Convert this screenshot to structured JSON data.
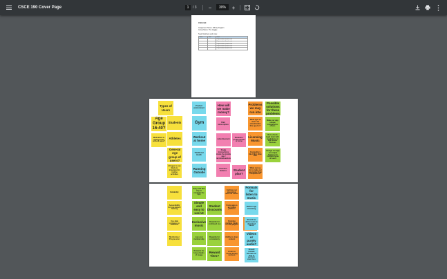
{
  "toolbar": {
    "title": "CSCE 190 Cover Page",
    "current_page": "1",
    "page_sep": "/",
    "total_pages": "3",
    "zoom_out": "−",
    "zoom": "30%",
    "zoom_in": "+",
    "icons": [
      "menu-icon",
      "fit-page-icon",
      "rotate-icon",
      "download-icon",
      "print-icon",
      "more-icon"
    ]
  },
  "page1": {
    "heading": "CSCE 190",
    "line1": "Assignment Name: Affinity Diagram",
    "line2": "Group Name: The Gaggle",
    "line3": "Team Members and roles:",
    "table": [
      [
        "Name",
        "Role",
        "Email"
      ],
      [
        "",
        "",
        "Project member @email.sc.edu"
      ],
      [
        "",
        "",
        "Project member @email.sc.edu"
      ],
      [
        "",
        "",
        "Project member @email.sc.edu"
      ],
      [
        "",
        "",
        "Project member @email.sc.edu"
      ],
      [
        "",
        "",
        "Project member @email.sc.edu"
      ]
    ]
  },
  "page2": {
    "yellow1": "Types of Users",
    "yellow2": "Age Group 16-40?",
    "yellow3": "Motivation to change even without apps?",
    "yellow4": "Students",
    "yellow5": "Athletes",
    "yellow6": "General Age group of users?",
    "yellow7": "All ages to use likely to integrated in routine activities",
    "cyan1": "Product environment",
    "cyan2": "Gym",
    "cyan3": "Workout at home",
    "cyan4": "Traditional Health",
    "cyan5": "Running Outside",
    "pink1": "How will we make money?",
    "pink2": "Paid subscription",
    "pink3": "Advertisement",
    "pink4": "Single transactions inside the mobile app / microtransactions",
    "pink5": "Students / professionals at home",
    "pink6": "Premium features",
    "pink7": "Student plan?",
    "orange1": "Problems we may run into",
    "orange2": "What type of users we should make this app for?",
    "orange3": "Licensing Music",
    "orange4": "Competitors like Fitbit, Nike Run",
    "orange5": "What can we do to make our app better than competitors?",
    "green1": "Possible solutions for these problems",
    "green2": "Make our app unique compared to others",
    "green3": "Run a fresh legal team with regulations to sign music licenses",
    "green4": "Design our app on unique features for multiple types of users"
  },
  "page3": {
    "y1": "Reliability",
    "y2": "Accessibility for low-vision / hearing",
    "y3": "Use data compare on workouts",
    "y4": "Monitoring / Progression",
    "g1": "Easy and fast way to navigate the app",
    "g2": "Simple and easy to use UI",
    "g3": "Student Discounts",
    "g4": "Exclusive music",
    "g5": "Rewards for continued use",
    "g6": "Low cost membership",
    "g7": "Rewards for consistency",
    "g8": "Rewards for long streaks of usage",
    "g9": "Reward Tiers?",
    "o1": "Getting user interaction with our music",
    "o2": "Using app as an online platform",
    "o3": "Running multiple tracks on one playlist",
    "o4": "Ability to share content",
    "o5": "Listen to sound during workout",
    "o6": "Background sound function",
    "c1": "Formats for listen to music",
    "c2": "Built-in app streaming",
    "c3": "Should we allow users to download music",
    "c4": "Videos or purely audio?",
    "c5": "Should include tutorials on how to perform exercises"
  }
}
